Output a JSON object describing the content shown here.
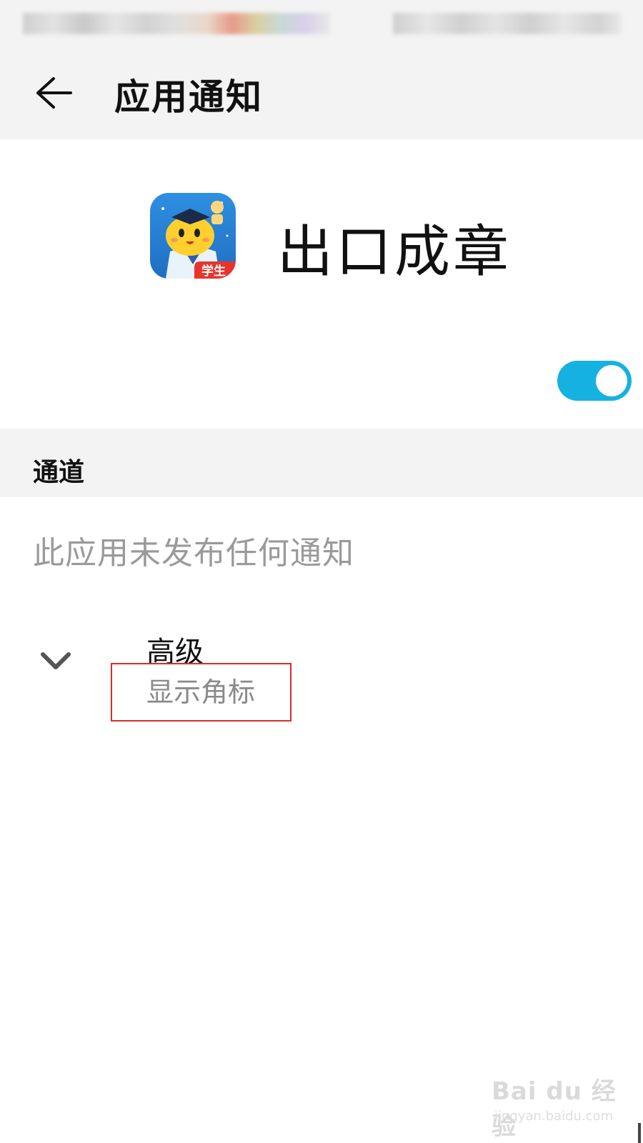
{
  "header": {
    "title": "应用通知",
    "back_icon": "arrow-left-icon"
  },
  "app": {
    "name": "出口成章",
    "icon_badge": "学生",
    "icon": "app-mascot-icon"
  },
  "notifications_toggle": {
    "state": "on",
    "accent_color": "#15b2e1"
  },
  "channels": {
    "section_title": "通道",
    "empty_text": "此应用未发布任何通知"
  },
  "advanced": {
    "title": "高级",
    "subtitle": "显示角标",
    "icon": "chevron-down-icon"
  },
  "annotation": {
    "highlight_color": "#d92b2b"
  },
  "watermark": {
    "brand": "Bai du 经验",
    "url": "jingyan.baidu.com"
  }
}
